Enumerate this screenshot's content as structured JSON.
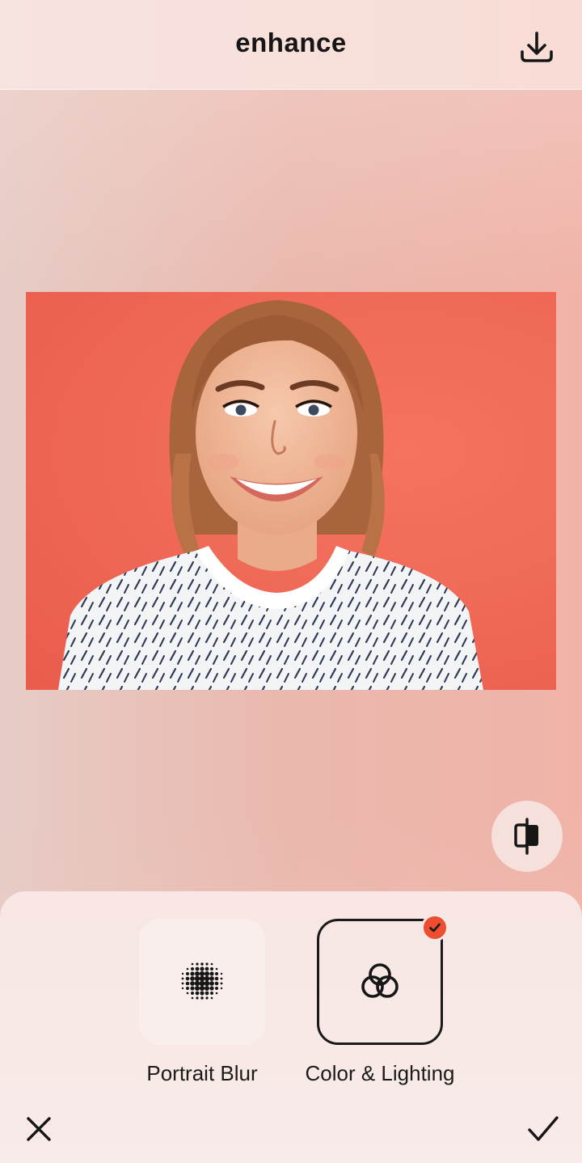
{
  "header": {
    "title": "enhance",
    "download_icon": "download-icon"
  },
  "canvas": {
    "photo": "portrait-photo",
    "compare_icon": "compare-split-icon"
  },
  "tools": [
    {
      "label": "Portrait Blur",
      "icon": "dot-grid-icon",
      "selected": false
    },
    {
      "label": "Color & Lighting",
      "icon": "interlocking-rings-icon",
      "selected": true
    }
  ],
  "footer": {
    "cancel_icon": "close-icon",
    "apply_icon": "checkmark-icon"
  },
  "colors": {
    "accent": "#ee4d2f",
    "text": "#161616"
  }
}
